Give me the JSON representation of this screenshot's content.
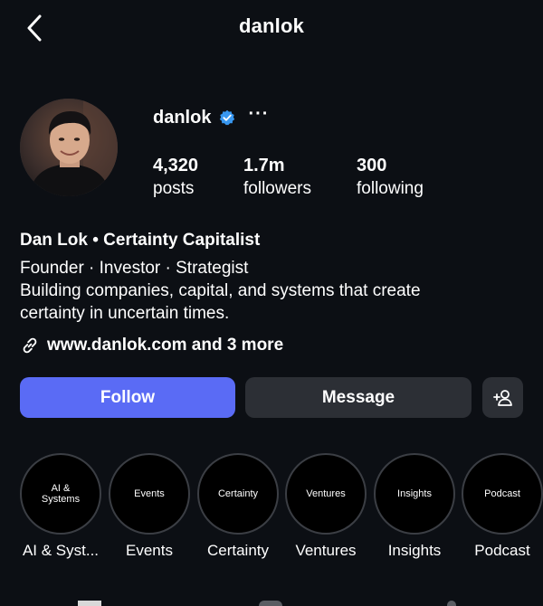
{
  "header": {
    "title": "danlok",
    "back_icon": "chevron-left-icon"
  },
  "profile": {
    "username": "danlok",
    "verified": true,
    "verified_color": "#3897f0",
    "stats": {
      "posts": {
        "value": "4,320",
        "label": "posts"
      },
      "followers": {
        "value": "1.7m",
        "label": "followers"
      },
      "following": {
        "value": "300",
        "label": "following"
      }
    }
  },
  "bio": {
    "name": "Dan Lok • Certainty Capitalist",
    "line1": "Founder · Investor · Strategist",
    "line2": "Building companies, capital, and systems that create",
    "line3": "certainty in uncertain times.",
    "link_text": "www.danlok.com and 3 more"
  },
  "actions": {
    "follow_label": "Follow",
    "message_label": "Message",
    "follow_color": "#5a6bf5",
    "add_user_icon": "add-user-icon"
  },
  "highlights": [
    {
      "cover": "AI &\nSystems",
      "label": "AI & Syst..."
    },
    {
      "cover": "Events",
      "label": "Events"
    },
    {
      "cover": "Certainty",
      "label": "Certainty"
    },
    {
      "cover": "Ventures",
      "label": "Ventures"
    },
    {
      "cover": "Insights",
      "label": "Insights"
    },
    {
      "cover": "Podcast",
      "label": "Podcast"
    }
  ]
}
